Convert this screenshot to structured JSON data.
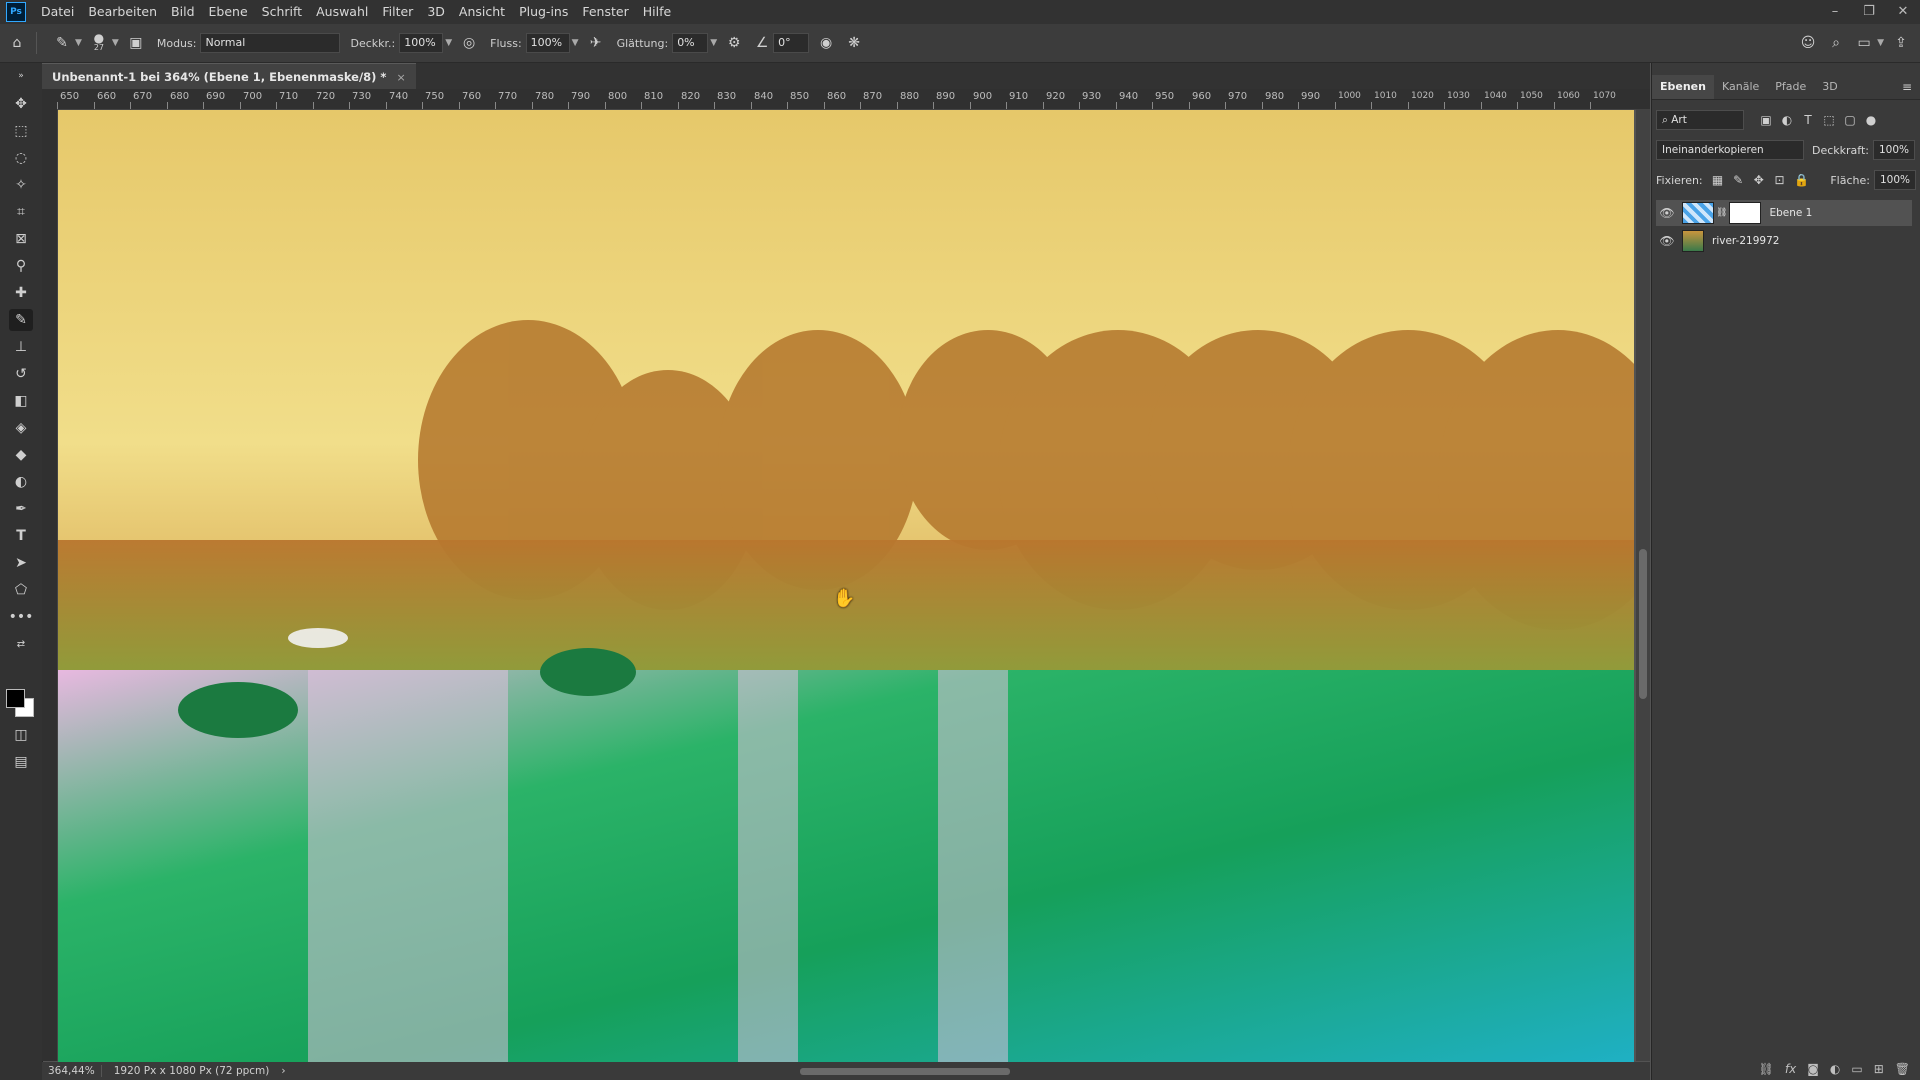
{
  "app": {
    "logo": "Ps"
  },
  "menu": [
    "Datei",
    "Bearbeiten",
    "Bild",
    "Ebene",
    "Schrift",
    "Auswahl",
    "Filter",
    "3D",
    "Ansicht",
    "Plug-ins",
    "Fenster",
    "Hilfe"
  ],
  "window_controls": {
    "minimize": "–",
    "restore": "❐",
    "close": "✕"
  },
  "options": {
    "brush_size": "27",
    "mode_label": "Modus:",
    "mode_value": "Normal",
    "opacity_label": "Deckkr.:",
    "opacity_value": "100%",
    "flow_label": "Fluss:",
    "flow_value": "100%",
    "smoothing_label": "Glättung:",
    "smoothing_value": "0%",
    "angle_value": "0°"
  },
  "document": {
    "tab_title": "Unbenannt-1 bei 364% (Ebene 1, Ebenenmaske/8) *",
    "close": "×"
  },
  "ruler_ticks": [
    "650",
    "660",
    "670",
    "680",
    "690",
    "700",
    "710",
    "720",
    "730",
    "740",
    "750",
    "760",
    "770",
    "780",
    "790",
    "800",
    "810",
    "820",
    "830",
    "840",
    "850",
    "860",
    "870",
    "880",
    "890",
    "900",
    "910",
    "920",
    "930",
    "940",
    "950",
    "960",
    "970",
    "980",
    "990",
    "1000",
    "1010",
    "1020",
    "1030",
    "1040",
    "1050",
    "1060",
    "1070"
  ],
  "status": {
    "zoom": "364,44%",
    "doc_size": "1920 Px x 1080 Px (72 ppcm)",
    "arrow": "›"
  },
  "panel": {
    "tabs": [
      "Ebenen",
      "Kanäle",
      "Pfade",
      "3D"
    ],
    "filter_kind": "Art",
    "blend_mode": "Ineinanderkopieren",
    "opacity_label": "Deckkraft:",
    "opacity_value": "100%",
    "lock_label": "Fixieren:",
    "fill_label": "Fläche:",
    "fill_value": "100%",
    "layers": [
      {
        "name": "Ebene 1",
        "visible": true,
        "selected": true
      },
      {
        "name": "river-219972",
        "visible": true,
        "selected": false
      }
    ]
  },
  "colors": {
    "accent": "#31a8ff",
    "panel_bg": "#3a3a3a",
    "menubar_bg": "#323232"
  }
}
